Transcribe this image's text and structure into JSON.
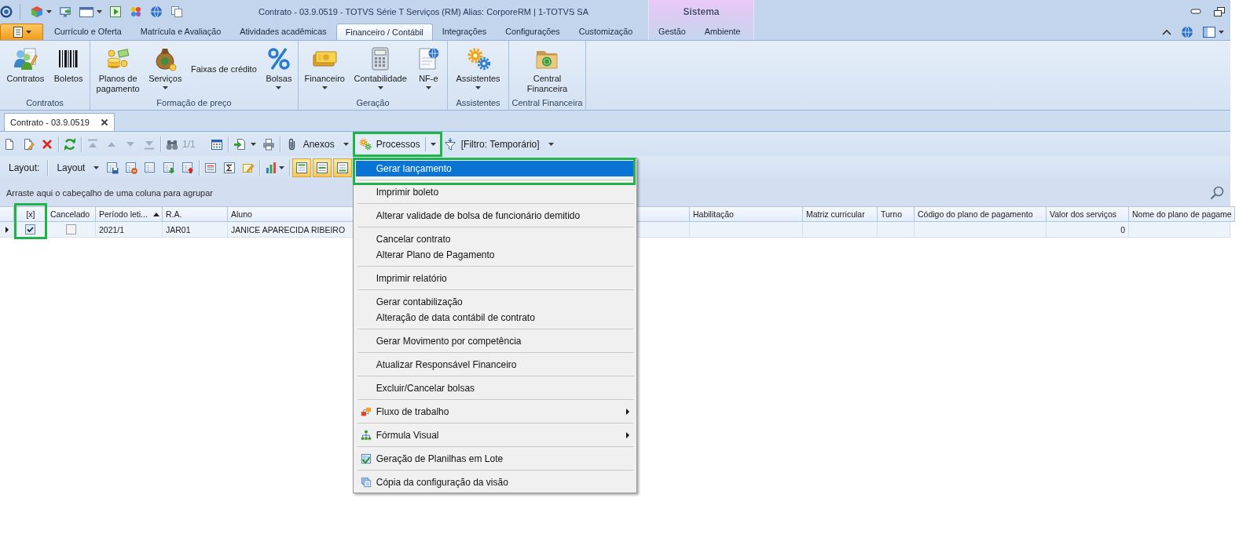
{
  "window": {
    "title": "Contrato - 03.9.0519 - TOTVS Série T Serviços (RM) Alias: CorporeRM | 1-TOTVS SA"
  },
  "ribbon_tabs": [
    {
      "label": "Currículo e Oferta",
      "selected": false
    },
    {
      "label": "Matrícula e Avaliação",
      "selected": false
    },
    {
      "label": "Atividades acadêmicas",
      "selected": false
    },
    {
      "label": "Financeiro / Contábil",
      "selected": true
    },
    {
      "label": "Integrações",
      "selected": false
    },
    {
      "label": "Configurações",
      "selected": false
    },
    {
      "label": "Customização",
      "selected": false
    }
  ],
  "contextual_tab_group": {
    "title": "Sistema",
    "tabs": [
      {
        "label": "Gestão",
        "selected": false
      },
      {
        "label": "Ambiente",
        "selected": false
      }
    ]
  },
  "ribbon_groups": [
    {
      "label": "Contratos",
      "buttons": [
        {
          "label": "Contratos",
          "kind": "large",
          "dropdown": false
        },
        {
          "label": "Boletos",
          "kind": "large",
          "dropdown": false
        }
      ]
    },
    {
      "label": "Formação de preço",
      "buttons": [
        {
          "label": "Planos de pagamento",
          "kind": "large",
          "dropdown": false
        },
        {
          "label": "Serviços",
          "kind": "large",
          "dropdown": true
        },
        {
          "label": "Faixas de crédito",
          "kind": "small",
          "dropdown": false
        },
        {
          "label": "Bolsas",
          "kind": "large",
          "dropdown": true
        }
      ]
    },
    {
      "label": "Geração",
      "buttons": [
        {
          "label": "Financeiro",
          "kind": "large",
          "dropdown": true
        },
        {
          "label": "Contabilidade",
          "kind": "large",
          "dropdown": true
        },
        {
          "label": "NF-e",
          "kind": "large",
          "dropdown": true
        }
      ]
    },
    {
      "label": "Assistentes",
      "buttons": [
        {
          "label": "Assistentes",
          "kind": "large",
          "dropdown": true
        }
      ]
    },
    {
      "label": "Central Financeira",
      "buttons": [
        {
          "label": "Central Financeira",
          "kind": "large",
          "dropdown": false
        }
      ]
    }
  ],
  "document_tabs": [
    {
      "label": "Contrato - 03.9.0519",
      "selected": true
    }
  ],
  "main_toolbar": {
    "groups": [
      {
        "items": [
          {
            "kind": "icon",
            "disabled": false,
            "highlighted": false
          },
          {
            "kind": "icon",
            "disabled": false,
            "highlighted": false
          },
          {
            "kind": "icon",
            "disabled": false,
            "highlighted": false
          }
        ]
      },
      {
        "items": [
          {
            "kind": "icon",
            "disabled": false,
            "highlighted": false
          }
        ]
      },
      {
        "items": [
          {
            "kind": "icon",
            "disabled": true,
            "highlighted": false
          },
          {
            "kind": "icon",
            "disabled": true,
            "highlighted": false
          },
          {
            "kind": "icon",
            "disabled": true,
            "highlighted": false
          },
          {
            "kind": "icon",
            "disabled": true,
            "highlighted": false
          }
        ]
      },
      {
        "items": [
          {
            "kind": "icon",
            "disabled": false,
            "highlighted": false
          },
          {
            "kind": "counter",
            "label": "1/1",
            "disabled": true,
            "highlighted": false
          },
          {
            "kind": "icon",
            "disabled": false,
            "highlighted": false
          }
        ]
      },
      {
        "items": [
          {
            "kind": "dropdown-icon",
            "disabled": false,
            "highlighted": false
          },
          {
            "kind": "icon",
            "disabled": false,
            "highlighted": false
          }
        ]
      },
      {
        "items": [
          {
            "kind": "button",
            "label": "Anexos",
            "disabled": false,
            "dropdown": true,
            "expanded": false,
            "highlighted": false
          },
          {
            "kind": "split-button",
            "label": "Processos",
            "disabled": false,
            "dropdown": true,
            "expanded": true,
            "highlighted": true,
            "menu": {
              "groups": [
                {
                  "items": [
                    {
                      "label": "Gerar lançamento",
                      "kind": "text",
                      "selected": true,
                      "highlighted": true,
                      "submenu": false
                    }
                  ]
                },
                {
                  "items": [
                    {
                      "label": "Imprimir boleto",
                      "kind": "text",
                      "selected": false,
                      "highlighted": false,
                      "submenu": false
                    }
                  ]
                },
                {
                  "items": [
                    {
                      "label": "Alterar validade de bolsa de funcionário demitido",
                      "kind": "text",
                      "selected": false,
                      "highlighted": false,
                      "submenu": false
                    }
                  ]
                },
                {
                  "items": [
                    {
                      "label": "Cancelar contrato",
                      "kind": "text",
                      "selected": false,
                      "highlighted": false,
                      "submenu": false
                    },
                    {
                      "label": "Alterar Plano de Pagamento",
                      "kind": "text",
                      "selected": false,
                      "highlighted": false,
                      "submenu": false
                    }
                  ]
                },
                {
                  "items": [
                    {
                      "label": "Imprimir relatório",
                      "kind": "text",
                      "selected": false,
                      "highlighted": false,
                      "submenu": false
                    }
                  ]
                },
                {
                  "items": [
                    {
                      "label": "Gerar contabilização",
                      "kind": "text",
                      "selected": false,
                      "highlighted": false,
                      "submenu": false
                    },
                    {
                      "label": "Alteração de data contábil de contrato",
                      "kind": "text",
                      "selected": false,
                      "highlighted": false,
                      "submenu": false
                    }
                  ]
                },
                {
                  "items": [
                    {
                      "label": "Gerar Movimento por competência",
                      "kind": "text",
                      "selected": false,
                      "highlighted": false,
                      "submenu": false
                    }
                  ]
                },
                {
                  "items": [
                    {
                      "label": "Atualizar Responsável Financeiro",
                      "kind": "text",
                      "selected": false,
                      "highlighted": false,
                      "submenu": false
                    }
                  ]
                },
                {
                  "items": [
                    {
                      "label": "Excluir/Cancelar bolsas",
                      "kind": "text",
                      "selected": false,
                      "highlighted": false,
                      "submenu": false
                    }
                  ]
                },
                {
                  "items": [
                    {
                      "label": "Fluxo de trabalho",
                      "kind": "icon",
                      "selected": false,
                      "highlighted": false,
                      "submenu": true
                    }
                  ]
                },
                {
                  "items": [
                    {
                      "label": "Fórmula Visual",
                      "kind": "icon",
                      "selected": false,
                      "highlighted": false,
                      "submenu": true
                    }
                  ]
                },
                {
                  "items": [
                    {
                      "label": "Geração de Planilhas em Lote",
                      "kind": "icon",
                      "selected": false,
                      "highlighted": false,
                      "submenu": false
                    }
                  ]
                },
                {
                  "items": [
                    {
                      "label": "Cópia da configuração da visão",
                      "kind": "icon",
                      "selected": false,
                      "highlighted": false,
                      "submenu": false
                    }
                  ]
                }
              ]
            }
          },
          {
            "kind": "button",
            "label": "[Filtro: Temporário]",
            "disabled": false,
            "dropdown": true,
            "expanded": false,
            "highlighted": false
          }
        ]
      }
    ]
  },
  "layout_toolbar": {
    "groups": [
      {
        "items": [
          {
            "kind": "label",
            "label": "Layout:"
          }
        ]
      },
      {
        "items": [
          {
            "kind": "button",
            "label": "Layout",
            "dropdown": true
          },
          {
            "kind": "icon"
          },
          {
            "kind": "icon"
          },
          {
            "kind": "icon"
          },
          {
            "kind": "icon"
          },
          {
            "kind": "icon"
          }
        ]
      },
      {
        "items": [
          {
            "kind": "icon"
          },
          {
            "kind": "icon"
          },
          {
            "kind": "icon"
          }
        ]
      },
      {
        "items": [
          {
            "kind": "dropdown-icon"
          }
        ]
      },
      {
        "items": [
          {
            "kind": "toggle",
            "checked": true
          },
          {
            "kind": "toggle",
            "checked": true
          },
          {
            "kind": "toggle",
            "checked": true
          }
        ]
      }
    ]
  },
  "group_panel": {
    "hint": "Arraste aqui o cabeçalho de uma coluna para agrupar"
  },
  "grid": {
    "columns": [
      {
        "label": "[x]",
        "sorted": false,
        "highlighted": true
      },
      {
        "label": "Cancelado",
        "sorted": false,
        "highlighted": false
      },
      {
        "label": "Período leti...",
        "sorted": true,
        "highlighted": false
      },
      {
        "label": "R.A.",
        "sorted": false,
        "highlighted": false
      },
      {
        "label": "Aluno",
        "sorted": false,
        "highlighted": false
      },
      {
        "label": "Habilitação",
        "sorted": false,
        "highlighted": false
      },
      {
        "label": "Matriz curricular",
        "sorted": false,
        "highlighted": false
      },
      {
        "label": "Turno",
        "sorted": false,
        "highlighted": false
      },
      {
        "label": "Código do plano de pagamento",
        "sorted": false,
        "highlighted": false
      },
      {
        "label": "Valor dos serviços",
        "sorted": false,
        "highlighted": false
      },
      {
        "label": "Nome do plano de pagame",
        "sorted": false,
        "highlighted": false
      }
    ],
    "rows": [
      {
        "current": true,
        "cells": [
          {
            "kind": "checkbox",
            "checked": true
          },
          {
            "kind": "checkbox",
            "checked": false
          },
          {
            "kind": "text",
            "text": "2021/1"
          },
          {
            "kind": "text",
            "text": "JAR01"
          },
          {
            "kind": "text",
            "text": "JANICE APARECIDA RIBEIRO"
          },
          {
            "kind": "empty"
          },
          {
            "kind": "empty"
          },
          {
            "kind": "empty"
          },
          {
            "kind": "empty"
          },
          {
            "kind": "number",
            "text": "0"
          },
          {
            "kind": "empty"
          }
        ]
      }
    ]
  }
}
